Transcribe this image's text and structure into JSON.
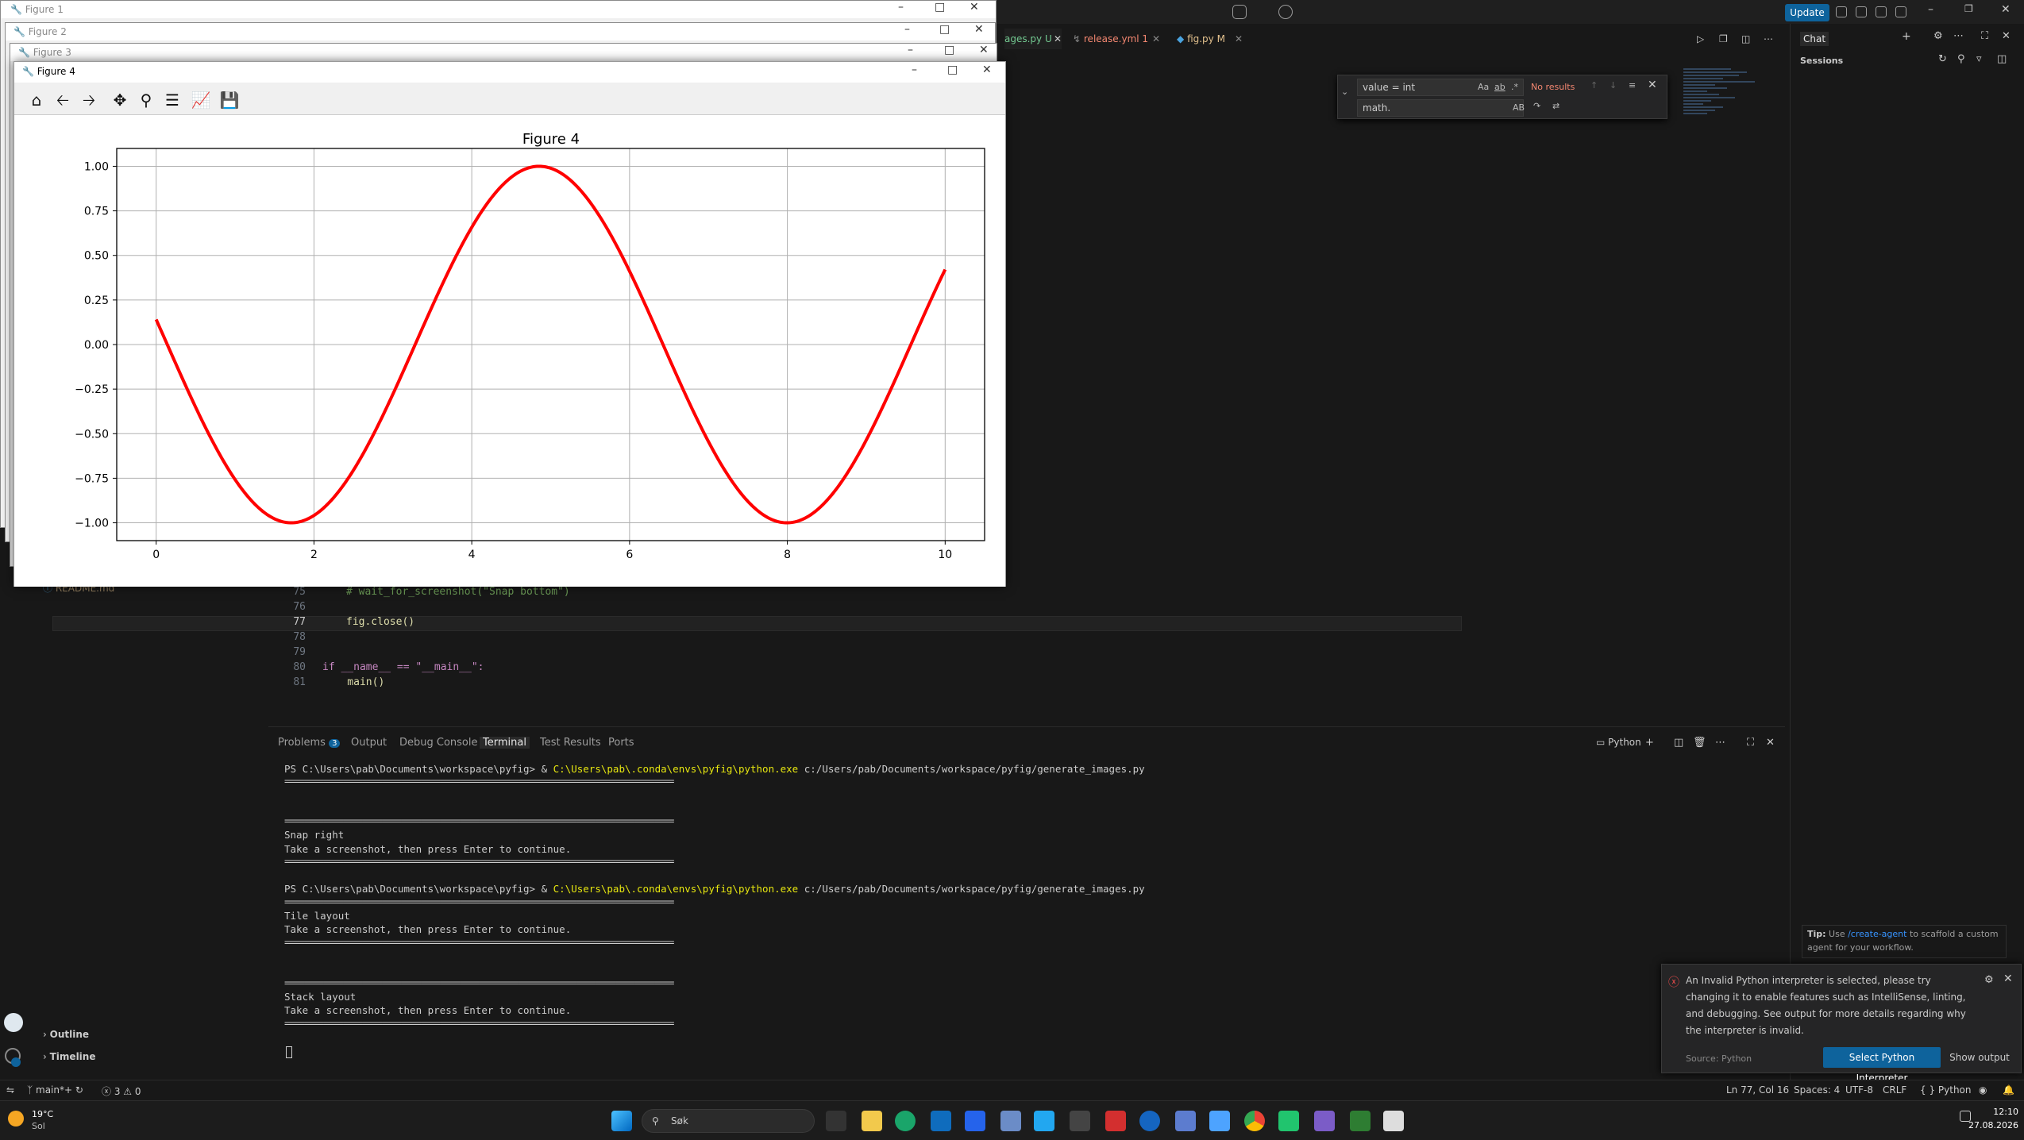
{
  "vscode": {
    "update_label": "Update",
    "tabs": [
      {
        "label": "ages.py",
        "badge": "U"
      },
      {
        "label": "release.yml",
        "badge": "1"
      },
      {
        "label": "fig.py",
        "badge": "M"
      }
    ],
    "find": {
      "value": "value = int",
      "opts": "Aa",
      "opts2": "ab",
      "regex": ".*",
      "result": "No results",
      "replace": "math.",
      "replace_opt": "AB"
    },
    "editor_lines": [
      {
        "n": "75",
        "code": "# wait_for_screenshot(\"Snap bottom\")"
      },
      {
        "n": "76",
        "code": ""
      },
      {
        "n": "77",
        "code": "fig.close()"
      },
      {
        "n": "78",
        "code": ""
      },
      {
        "n": "79",
        "code": ""
      },
      {
        "n": "80",
        "code": "if __name__ == \"__main__\":"
      },
      {
        "n": "81",
        "code": "    main()"
      }
    ],
    "sidebar": {
      "readme": "README.md",
      "outline": "Outline",
      "timeline": "Timeline"
    },
    "panel_tabs": {
      "problems": "Problems",
      "problems_count": "3",
      "output": "Output",
      "debug": "Debug Console",
      "terminal": "Terminal",
      "tests": "Test Results",
      "ports": "Ports",
      "shell": "Python"
    },
    "terminal": {
      "prompt": "PS C:\\Users\\pab\\Documents\\workspace\\pyfig> & ",
      "exe": "C:\\Users\\pab\\.conda\\envs\\pyfig\\python.exe",
      "script": " c:/Users/pab/Documents/workspace/pyfig/generate_images.py",
      "sep": "================================================================================",
      "snap_right": "Snap right",
      "tile": "Tile layout",
      "stack": "Stack layout",
      "take": "Take a screenshot, then press Enter to continue."
    },
    "chat": {
      "title": "Chat",
      "sessions": "Sessions",
      "tip_label": "Tip:",
      "tip_pre": " Use ",
      "tip_link": "/create-agent",
      "tip_post": " to scaffold a custom agent for your workflow."
    },
    "notification": {
      "msg": "An Invalid Python interpreter is selected, please try changing it to enable features such as IntelliSense, linting, and debugging. See output for more details regarding why the interpreter is invalid.",
      "source": "Source: Python",
      "btn1": "Select Python Interpreter",
      "btn2": "Show output"
    },
    "status": {
      "branch": "main*+",
      "errors": "3",
      "warnings": "0",
      "pos": "Ln 77, Col 16",
      "spaces": "Spaces: 4",
      "enc": "UTF-8",
      "eol": "CRLF",
      "lang": "Python"
    }
  },
  "figures": {
    "f1": "Figure 1",
    "f2": "Figure 2",
    "f3": "Figure 3",
    "f4": "Figure 4"
  },
  "taskbar": {
    "temp": "19°C",
    "weather": "Sol",
    "search": "Søk",
    "time": "12:10",
    "date": "27.08.2026"
  },
  "chart_data": {
    "type": "line",
    "title": "Figure 4",
    "xlabel": "",
    "ylabel": "",
    "xlim": [
      -0.5,
      10.5
    ],
    "ylim": [
      -1.1,
      1.1
    ],
    "xticks": [
      0,
      2,
      4,
      6,
      8,
      10
    ],
    "yticks": [
      1.0,
      0.75,
      0.5,
      0.25,
      0.0,
      -0.25,
      -0.5,
      -0.75,
      -1.0
    ],
    "ytick_labels": [
      "1.00",
      "0.75",
      "0.50",
      "0.25",
      "0.00",
      "−0.25",
      "−0.50",
      "−0.75",
      "−1.00"
    ],
    "grid": true,
    "series": [
      {
        "color": "#ff0000",
        "function": "y = cos(x + 1.43)",
        "x_range": [
          0,
          10
        ],
        "samples": [
          [
            0,
            0.14
          ],
          [
            1.71,
            -1.0
          ],
          [
            3.0,
            -0.38
          ],
          [
            4.85,
            1.0
          ],
          [
            6.0,
            0.45
          ],
          [
            7.99,
            -1.0
          ],
          [
            10,
            0.42
          ]
        ]
      }
    ]
  }
}
